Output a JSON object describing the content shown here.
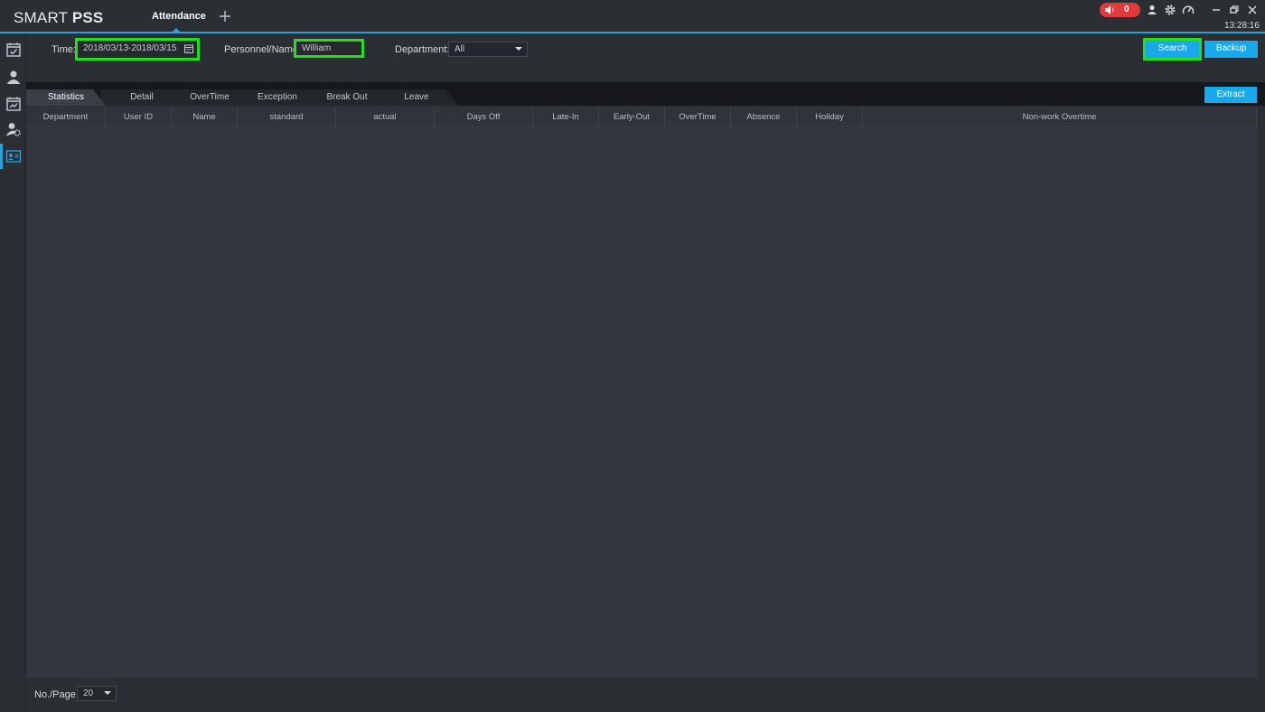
{
  "app": {
    "brand_light": "SMART ",
    "brand_bold": "PSS",
    "accent": "#2a9fd8",
    "clock": "13:28:16"
  },
  "titlebar": {
    "active_tab": "Attendance",
    "add_tab_icon": "plus-icon",
    "alarm_count": "0",
    "icons": [
      "speaker-icon",
      "user-icon",
      "gear-icon",
      "speedometer-icon",
      "minimize-icon",
      "restore-icon",
      "close-icon"
    ]
  },
  "rail": {
    "icons": [
      "calendar-check-icon",
      "personnel-icon",
      "schedule-icon",
      "user-settings-icon",
      "attendance-report-icon"
    ]
  },
  "filters": {
    "time_label": "Time:",
    "time_value": "2018/03/13-2018/03/15",
    "personnel_label": "Personnel/Name:",
    "personnel_value": "William",
    "department_label": "Department:",
    "department_value": "All",
    "search_label": "Search",
    "backup_label": "Backup"
  },
  "tabs": [
    "Statistics",
    "Detail",
    "OverTime",
    "Exception",
    "Break Out",
    "Leave"
  ],
  "active_tab_index": 0,
  "extract_label": "Extract",
  "table": {
    "columns": [
      "Department",
      "User ID",
      "Name",
      "standard",
      "actual",
      "Days Off",
      "Late-In",
      "Early-Out",
      "OverTime",
      "Absence",
      "Holiday",
      "Non-work Overtime"
    ],
    "rows": []
  },
  "footer": {
    "page_size_label": "No./Page",
    "page_size_value": "20"
  },
  "highlight_color": "#22e01a"
}
